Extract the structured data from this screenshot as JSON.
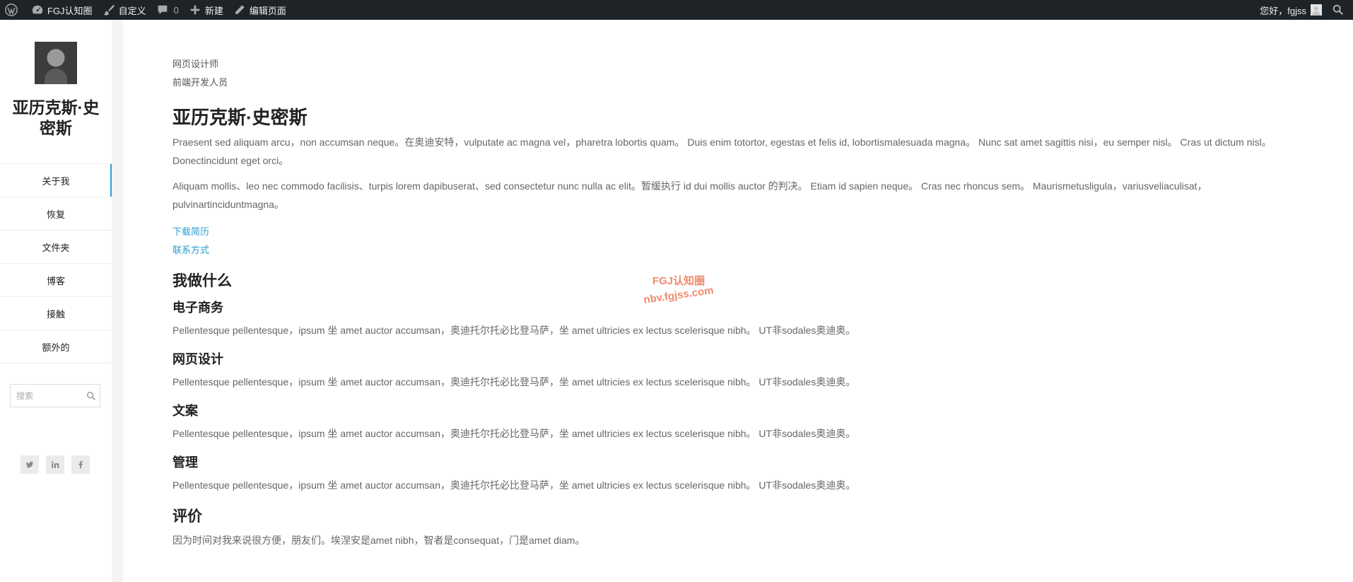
{
  "adminbar": {
    "site_name": "FGJ认知圈",
    "customize": "自定义",
    "comments_count": "0",
    "new": "新建",
    "edit_page": "编辑页面",
    "greeting": "您好，fgjss"
  },
  "sidebar": {
    "site_name": "亚历克斯·史密斯",
    "nav": [
      {
        "label": "关于我"
      },
      {
        "label": "恢复"
      },
      {
        "label": "文件夹"
      },
      {
        "label": "博客"
      },
      {
        "label": "接触"
      },
      {
        "label": "额外的"
      }
    ],
    "search_placeholder": "搜索",
    "social": [
      "twitter-icon",
      "linkedin-icon",
      "facebook-icon"
    ]
  },
  "main": {
    "role1": "网页设计师",
    "role2": "前端开发人员",
    "name": "亚历克斯·史密斯",
    "para1": "Praesent sed aliquam arcu，non accumsan neque。在奥迪安特，vulputate ac magna vel，pharetra lobortis quam。 Duis enim totortor, egestas et felis id, lobortismalesuada magna。 Nunc sat amet sagittis nisi，eu semper nisl。 Cras ut dictum nisl。 Donectincidunt eget orci。",
    "para2": "Aliquam mollis、leo nec commodo facilisis、turpis lorem dapibuserat、sed consectetur nunc nulla ac elit。暂缓执行 id dui mollis auctor 的判决。 Etiam id sapien neque。 Cras nec rhoncus sem。 Maurismetusligula，variusveliaculisat，pulvinartinciduntmagna。",
    "download_cv": "下载简历",
    "contact": "联系方式",
    "what_i_do": "我做什么",
    "services": [
      {
        "title": "电子商务",
        "desc": "Pellentesque pellentesque，ipsum 坐 amet auctor accumsan，奥迪托尔托必比登马萨，坐 amet ultricies ex lectus scelerisque nibh。 UT非sodales奥迪奥。"
      },
      {
        "title": "网页设计",
        "desc": "Pellentesque pellentesque，ipsum 坐 amet auctor accumsan，奥迪托尔托必比登马萨，坐 amet ultricies ex lectus scelerisque nibh。 UT非sodales奥迪奥。"
      },
      {
        "title": "文案",
        "desc": "Pellentesque pellentesque，ipsum 坐 amet auctor accumsan，奥迪托尔托必比登马萨，坐 amet ultricies ex lectus scelerisque nibh。 UT非sodales奥迪奥。"
      },
      {
        "title": "管理",
        "desc": "Pellentesque pellentesque，ipsum 坐 amet auctor accumsan，奥迪托尔托必比登马萨，坐 amet ultricies ex lectus scelerisque nibh。 UT非sodales奥迪奥。"
      }
    ],
    "testimonials_title": "评价",
    "testimonial_text": "因为时间对我来说很方便，朋友们。埃涅安是amet nibh，智者是consequat，门是amet diam。"
  },
  "watermark": {
    "line1": "FGJ认知圈",
    "line2": "nbv.fgjss.com"
  },
  "colors": {
    "adminbar_bg": "#1d2327",
    "accent": "#2b9dd3",
    "watermark": "#f08a6c"
  }
}
